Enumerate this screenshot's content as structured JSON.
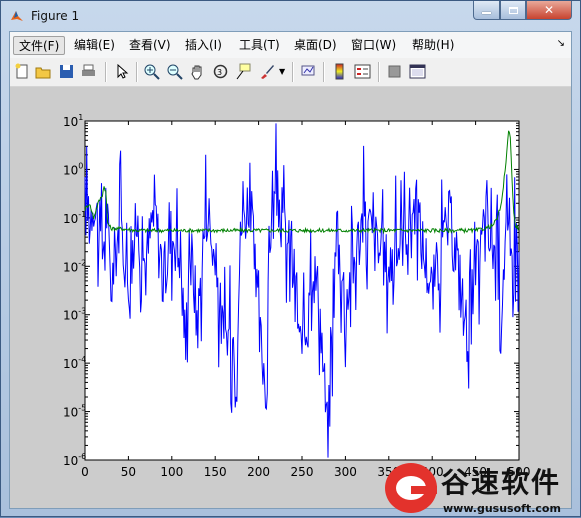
{
  "window": {
    "title": "Figure 1"
  },
  "menu": {
    "items": [
      {
        "label": "文件(F)",
        "selected": true
      },
      {
        "label": "编辑(E)"
      },
      {
        "label": "查看(V)"
      },
      {
        "label": "插入(I)"
      },
      {
        "label": "工具(T)"
      },
      {
        "label": "桌面(D)"
      },
      {
        "label": "窗口(W)"
      },
      {
        "label": "帮助(H)"
      }
    ]
  },
  "toolbar": {
    "icons": [
      "new-figure-icon",
      "open-file-icon",
      "save-icon",
      "print-icon",
      "edit-plot-arrow-icon",
      "zoom-in-icon",
      "zoom-out-icon",
      "pan-hand-icon",
      "rotate-3d-icon",
      "data-cursor-icon",
      "brush-icon",
      "brush-dropdown-icon",
      "link-plot-icon",
      "colorbar-icon",
      "legend-icon",
      "hide-plot-tools-icon",
      "show-plot-tools-icon"
    ]
  },
  "chart_data": {
    "type": "line",
    "title": "",
    "xlabel": "",
    "ylabel": "",
    "xlim": [
      0,
      500
    ],
    "ylim": [
      1e-06,
      10
    ],
    "yscale": "log",
    "x_ticks": [
      "0",
      "50",
      "100",
      "150",
      "200",
      "250",
      "300",
      "350",
      "400",
      "450",
      "500"
    ],
    "y_ticks": [
      {
        "base": "10",
        "exp": "1"
      },
      {
        "base": "10",
        "exp": "0"
      },
      {
        "base": "10",
        "exp": "-1"
      },
      {
        "base": "10",
        "exp": "-2"
      },
      {
        "base": "10",
        "exp": "-3"
      },
      {
        "base": "10",
        "exp": "-4"
      },
      {
        "base": "10",
        "exp": "-5"
      },
      {
        "base": "10",
        "exp": "-6"
      }
    ],
    "series": [
      {
        "color": "#0000ff",
        "x": [
          0,
          5,
          10,
          15,
          20,
          25,
          30,
          40,
          50,
          60,
          70,
          80,
          90,
          100,
          110,
          116,
          120,
          130,
          140,
          150,
          160,
          175,
          180,
          190,
          200,
          210,
          212,
          220,
          240,
          250,
          260,
          270,
          280,
          282,
          290,
          300,
          320,
          350,
          380,
          400,
          420,
          440,
          460,
          470,
          480,
          485,
          490,
          495,
          500
        ],
        "y": [
          0.2,
          0.1,
          0.3,
          0.08,
          0.02,
          0.15,
          0.004,
          0.1,
          0.005,
          0.08,
          0.01,
          0.2,
          0.004,
          0.06,
          0.02,
          0.0002,
          0.05,
          0.0008,
          0.3,
          0.01,
          0.0003,
          0.0004,
          0.08,
          0.3,
          0.0005,
          3e-05,
          0.04,
          0.3,
          0.01,
          0.0001,
          0.02,
          0.002,
          2e-06,
          4e-05,
          0.05,
          0.002,
          0.1,
          0.01,
          0.2,
          0.003,
          0.1,
          0.0005,
          0.05,
          0.03,
          0.003,
          0.05,
          0.01,
          0.06,
          0.02
        ]
      },
      {
        "color": "#008000",
        "x": [
          0,
          5,
          10,
          15,
          20,
          22,
          24,
          26,
          30,
          40,
          60,
          100,
          150,
          200,
          250,
          300,
          350,
          400,
          450,
          460,
          470,
          475,
          480,
          485,
          488,
          490,
          492,
          494,
          496,
          500
        ],
        "y": [
          0.15,
          0.2,
          0.1,
          0.2,
          0.3,
          0.45,
          0.35,
          0.08,
          0.06,
          0.06,
          0.055,
          0.055,
          0.055,
          0.055,
          0.055,
          0.055,
          0.055,
          0.055,
          0.055,
          0.06,
          0.07,
          0.1,
          0.2,
          1.5,
          6.0,
          5.0,
          0.6,
          0.12,
          0.07,
          0.06
        ]
      }
    ]
  },
  "watermark": {
    "text": "谷速软件",
    "url": "www.gususoft.com"
  },
  "colors": {
    "figure_bg": "#cccccc",
    "axes_bg": "#ffffff"
  }
}
